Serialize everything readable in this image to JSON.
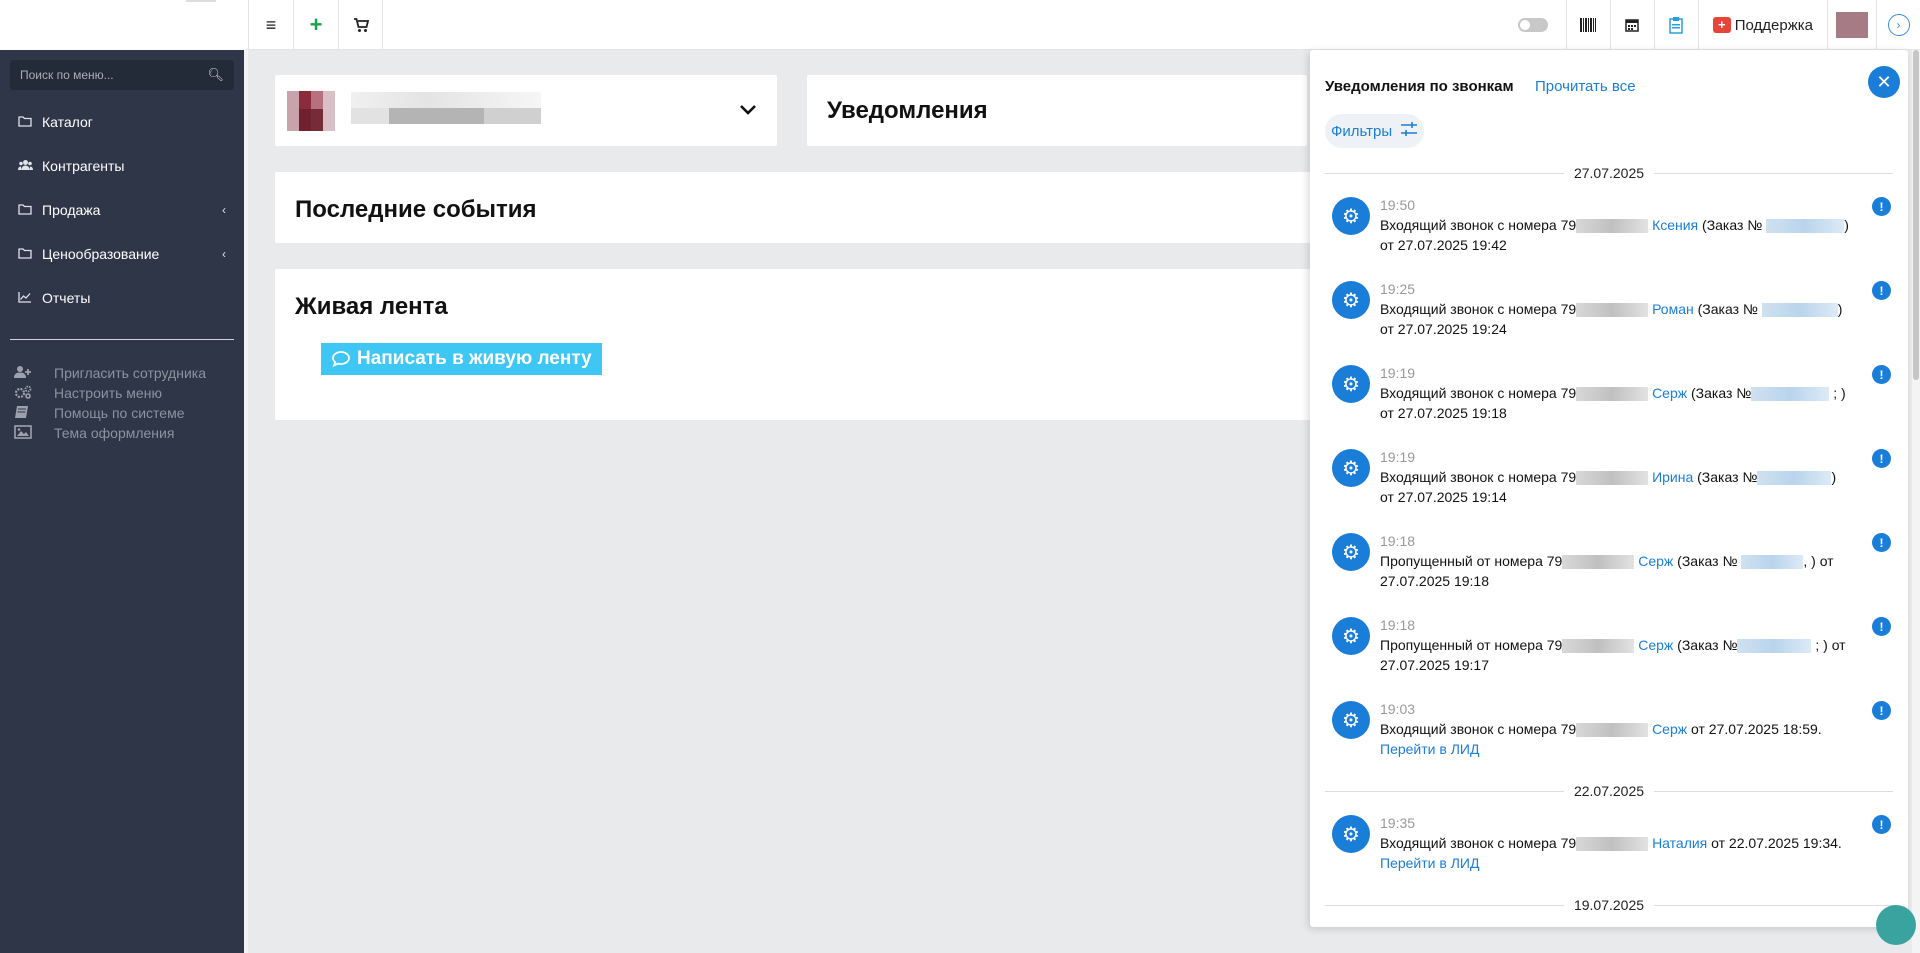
{
  "topbar": {
    "left_buttons": [
      {
        "icon": "hamburger-icon",
        "glyph": "≡"
      },
      {
        "icon": "plus-icon",
        "glyph": "+"
      },
      {
        "icon": "cart-icon",
        "glyph": "🛒"
      }
    ],
    "support_label": "Поддержка"
  },
  "sidebar": {
    "search_placeholder": "Поиск по меню...",
    "items": [
      {
        "icon": "folder-icon",
        "label": "Каталог",
        "has_chevron": false
      },
      {
        "icon": "users-icon",
        "label": "Контрагенты",
        "has_chevron": false
      },
      {
        "icon": "folder-icon",
        "label": "Продажа",
        "has_chevron": true
      },
      {
        "icon": "folder-icon",
        "label": "Ценообразование",
        "has_chevron": true
      },
      {
        "icon": "chart-icon",
        "label": "Отчеты",
        "has_chevron": false
      }
    ],
    "tools": [
      {
        "icon": "add-user-icon",
        "label": "Пригласить сотрудника"
      },
      {
        "icon": "gears-icon",
        "label": "Настроить меню"
      },
      {
        "icon": "book-icon",
        "label": "Помощь по системе"
      },
      {
        "icon": "image-icon",
        "label": "Тема оформления"
      }
    ]
  },
  "main": {
    "notifications_title": "Уведомления",
    "events_title": "Последние события",
    "feed_title": "Живая лента",
    "feed_button": "Написать в живую ленту"
  },
  "panel": {
    "title": "Уведомления по звонкам",
    "read_all": "Прочитать все",
    "filters_label": "Фильтры",
    "dates": [
      "27.07.2025",
      "22.07.2025",
      "19.07.2025"
    ],
    "notifications": [
      {
        "time": "19:50",
        "prefix": "Входящий звонок с  номера 79",
        "contact": "Ксения",
        "mid": " (Заказ № ",
        "tail": ")",
        "line2": "от 27.07.2025 19:42",
        "lead": ""
      },
      {
        "time": "19:25",
        "prefix": "Входящий звонок с  номера 79",
        "contact": "Роман",
        "mid": " (Заказ № ",
        "tail": ")",
        "line2": "от 27.07.2025 19:24",
        "lead": ""
      },
      {
        "time": "19:19",
        "prefix": "Входящий звонок с  номера 79",
        "contact": "Серж",
        "mid": " (Заказ №",
        "tail": "; )",
        "line2": "от 27.07.2025 19:18",
        "lead": ""
      },
      {
        "time": "19:19",
        "prefix": "Входящий звонок с  номера 79",
        "contact": "Ирина",
        "mid": " (Заказ №",
        "tail": ")",
        "line2": "от 27.07.2025 19:14",
        "lead": ""
      },
      {
        "time": "19:18",
        "prefix": "Пропущенный от  номера 79",
        "contact": "Серж",
        "mid": " (Заказ № ",
        "tail": ", ) от",
        "line2": "27.07.2025 19:18",
        "lead": ""
      },
      {
        "time": "19:18",
        "prefix": "Пропущенный от  номера 79",
        "contact": "Серж",
        "mid": " (Заказ №",
        "tail": "; ) от",
        "line2": "27.07.2025 19:17",
        "lead": ""
      },
      {
        "time": "19:03",
        "prefix": "Входящий звонок с  номера 79",
        "contact": "Серж",
        "mid": " от 27.07.2025 18:59.",
        "tail": "",
        "line2": "",
        "lead": "Перейти в ЛИД"
      },
      {
        "time": "19:35",
        "prefix": "Входящий звонок с  номера 79",
        "contact": "Наталия",
        "mid": " от 22.07.2025 19:34.",
        "tail": "",
        "line2": "",
        "lead": "Перейти в ЛИД"
      }
    ]
  },
  "colors": {
    "accent": "#1a7ed8",
    "sidebar_bg": "#2e3647",
    "feed_button": "#3ec6f4"
  }
}
